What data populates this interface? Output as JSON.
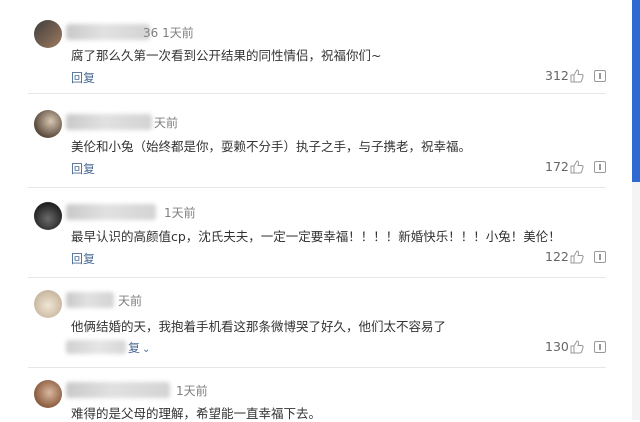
{
  "comments": [
    {
      "time": "36 1天前",
      "text": "腐了那么久第一次看到公开结果的同性情侣，祝福你们~",
      "reply": "回复",
      "likes": "312",
      "avatar_colors": [
        "#3d3d3d",
        "#a07b5f"
      ]
    },
    {
      "time": "天前",
      "text": "美伦和小兔（始终都是你，耍赖不分手）执子之手，与子携老，祝幸福。",
      "reply": "回复",
      "likes": "172",
      "avatar_colors": [
        "#5a4a3c",
        "#d8c6b2"
      ]
    },
    {
      "time": "1天前",
      "text": "最早认识的高颜值cp，沈氏夫夫，一定一定要幸福！！！！新婚快乐！！！小兔！美伦！",
      "reply": "回复",
      "likes": "122",
      "avatar_colors": [
        "#222222",
        "#6b6b6b"
      ]
    },
    {
      "time": "天前",
      "text": "他俩结婚的天，我抱着手机看这那条微博哭了好久，他们太不容易了",
      "reply": "复",
      "reply_suffix": "⌄",
      "likes": "130",
      "avatar_colors": [
        "#c9b8a0",
        "#f0e5d4"
      ]
    },
    {
      "time": "1天前",
      "text": "难得的是父母的理解，希望能一直幸福下去。",
      "reply": "",
      "likes": "",
      "avatar_colors": [
        "#8a5a3c",
        "#d9b8a0"
      ]
    }
  ],
  "icons": {
    "like": "thumbs-up-icon",
    "report": "report-icon"
  },
  "colors": {
    "reply_link": "#4c6b94",
    "scrollbar": "#2f6ad0"
  }
}
